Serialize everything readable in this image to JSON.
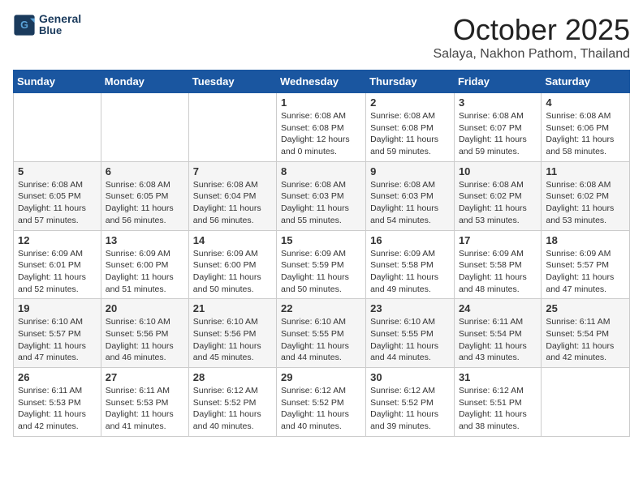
{
  "header": {
    "logo_line1": "General",
    "logo_line2": "Blue",
    "month_title": "October 2025",
    "location": "Salaya, Nakhon Pathom, Thailand"
  },
  "weekdays": [
    "Sunday",
    "Monday",
    "Tuesday",
    "Wednesday",
    "Thursday",
    "Friday",
    "Saturday"
  ],
  "weeks": [
    [
      {
        "day": "",
        "info": ""
      },
      {
        "day": "",
        "info": ""
      },
      {
        "day": "",
        "info": ""
      },
      {
        "day": "1",
        "info": "Sunrise: 6:08 AM\nSunset: 6:08 PM\nDaylight: 12 hours\nand 0 minutes."
      },
      {
        "day": "2",
        "info": "Sunrise: 6:08 AM\nSunset: 6:08 PM\nDaylight: 11 hours\nand 59 minutes."
      },
      {
        "day": "3",
        "info": "Sunrise: 6:08 AM\nSunset: 6:07 PM\nDaylight: 11 hours\nand 59 minutes."
      },
      {
        "day": "4",
        "info": "Sunrise: 6:08 AM\nSunset: 6:06 PM\nDaylight: 11 hours\nand 58 minutes."
      }
    ],
    [
      {
        "day": "5",
        "info": "Sunrise: 6:08 AM\nSunset: 6:05 PM\nDaylight: 11 hours\nand 57 minutes."
      },
      {
        "day": "6",
        "info": "Sunrise: 6:08 AM\nSunset: 6:05 PM\nDaylight: 11 hours\nand 56 minutes."
      },
      {
        "day": "7",
        "info": "Sunrise: 6:08 AM\nSunset: 6:04 PM\nDaylight: 11 hours\nand 56 minutes."
      },
      {
        "day": "8",
        "info": "Sunrise: 6:08 AM\nSunset: 6:03 PM\nDaylight: 11 hours\nand 55 minutes."
      },
      {
        "day": "9",
        "info": "Sunrise: 6:08 AM\nSunset: 6:03 PM\nDaylight: 11 hours\nand 54 minutes."
      },
      {
        "day": "10",
        "info": "Sunrise: 6:08 AM\nSunset: 6:02 PM\nDaylight: 11 hours\nand 53 minutes."
      },
      {
        "day": "11",
        "info": "Sunrise: 6:08 AM\nSunset: 6:02 PM\nDaylight: 11 hours\nand 53 minutes."
      }
    ],
    [
      {
        "day": "12",
        "info": "Sunrise: 6:09 AM\nSunset: 6:01 PM\nDaylight: 11 hours\nand 52 minutes."
      },
      {
        "day": "13",
        "info": "Sunrise: 6:09 AM\nSunset: 6:00 PM\nDaylight: 11 hours\nand 51 minutes."
      },
      {
        "day": "14",
        "info": "Sunrise: 6:09 AM\nSunset: 6:00 PM\nDaylight: 11 hours\nand 50 minutes."
      },
      {
        "day": "15",
        "info": "Sunrise: 6:09 AM\nSunset: 5:59 PM\nDaylight: 11 hours\nand 50 minutes."
      },
      {
        "day": "16",
        "info": "Sunrise: 6:09 AM\nSunset: 5:58 PM\nDaylight: 11 hours\nand 49 minutes."
      },
      {
        "day": "17",
        "info": "Sunrise: 6:09 AM\nSunset: 5:58 PM\nDaylight: 11 hours\nand 48 minutes."
      },
      {
        "day": "18",
        "info": "Sunrise: 6:09 AM\nSunset: 5:57 PM\nDaylight: 11 hours\nand 47 minutes."
      }
    ],
    [
      {
        "day": "19",
        "info": "Sunrise: 6:10 AM\nSunset: 5:57 PM\nDaylight: 11 hours\nand 47 minutes."
      },
      {
        "day": "20",
        "info": "Sunrise: 6:10 AM\nSunset: 5:56 PM\nDaylight: 11 hours\nand 46 minutes."
      },
      {
        "day": "21",
        "info": "Sunrise: 6:10 AM\nSunset: 5:56 PM\nDaylight: 11 hours\nand 45 minutes."
      },
      {
        "day": "22",
        "info": "Sunrise: 6:10 AM\nSunset: 5:55 PM\nDaylight: 11 hours\nand 44 minutes."
      },
      {
        "day": "23",
        "info": "Sunrise: 6:10 AM\nSunset: 5:55 PM\nDaylight: 11 hours\nand 44 minutes."
      },
      {
        "day": "24",
        "info": "Sunrise: 6:11 AM\nSunset: 5:54 PM\nDaylight: 11 hours\nand 43 minutes."
      },
      {
        "day": "25",
        "info": "Sunrise: 6:11 AM\nSunset: 5:54 PM\nDaylight: 11 hours\nand 42 minutes."
      }
    ],
    [
      {
        "day": "26",
        "info": "Sunrise: 6:11 AM\nSunset: 5:53 PM\nDaylight: 11 hours\nand 42 minutes."
      },
      {
        "day": "27",
        "info": "Sunrise: 6:11 AM\nSunset: 5:53 PM\nDaylight: 11 hours\nand 41 minutes."
      },
      {
        "day": "28",
        "info": "Sunrise: 6:12 AM\nSunset: 5:52 PM\nDaylight: 11 hours\nand 40 minutes."
      },
      {
        "day": "29",
        "info": "Sunrise: 6:12 AM\nSunset: 5:52 PM\nDaylight: 11 hours\nand 40 minutes."
      },
      {
        "day": "30",
        "info": "Sunrise: 6:12 AM\nSunset: 5:52 PM\nDaylight: 11 hours\nand 39 minutes."
      },
      {
        "day": "31",
        "info": "Sunrise: 6:12 AM\nSunset: 5:51 PM\nDaylight: 11 hours\nand 38 minutes."
      },
      {
        "day": "",
        "info": ""
      }
    ]
  ]
}
